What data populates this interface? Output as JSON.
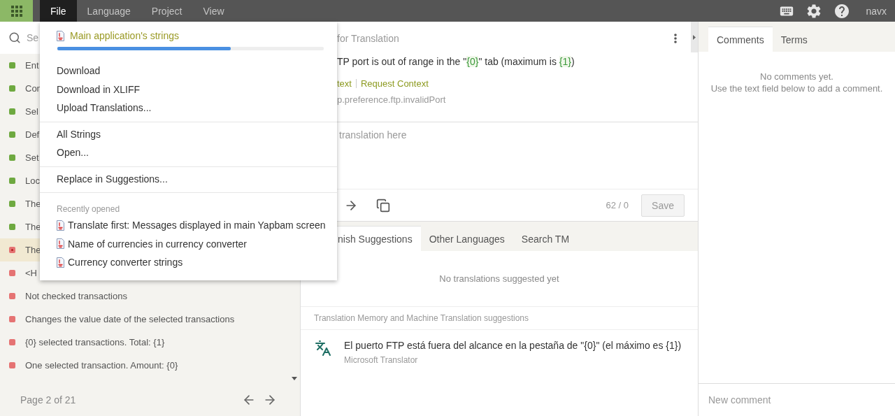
{
  "top_bar": {
    "menus": [
      {
        "label": "File",
        "selected": true
      },
      {
        "label": "Language",
        "selected": false
      },
      {
        "label": "Project",
        "selected": false
      },
      {
        "label": "View",
        "selected": false
      }
    ],
    "user": "navx"
  },
  "file_menu": {
    "current_file": {
      "name": "Main application's strings",
      "level": 0.65
    },
    "groups": [
      [
        "Download",
        "Download in XLIFF",
        "Upload Translations..."
      ],
      [
        "All Strings",
        "Open..."
      ],
      [
        "Replace in Suggestions..."
      ]
    ],
    "recent": {
      "heading": "Recently opened",
      "files": [
        "Translate first: Messages displayed in main Yapbam screen",
        "Name of currencies in currency converter",
        "Currency converter strings"
      ]
    }
  },
  "sidebar": {
    "search": {
      "placeholder": "Se"
    },
    "items": [
      {
        "text": "Ent",
        "color": "#6ea940",
        "selected": false
      },
      {
        "text": "Con",
        "color": "#6ea940",
        "selected": false
      },
      {
        "text": "Sel",
        "color": "#6ea940",
        "selected": false
      },
      {
        "text": "Def",
        "color": "#6ea940",
        "selected": false
      },
      {
        "text": "Set",
        "color": "#6ea940",
        "selected": false
      },
      {
        "text": "Loc",
        "color": "#6ea940",
        "selected": false
      },
      {
        "text": "The",
        "color": "#6ea940",
        "selected": false
      },
      {
        "text": "The",
        "color": "#6ea940",
        "selected": false
      },
      {
        "text": "The",
        "color": "#e57373",
        "selected": true
      },
      {
        "text": "<H",
        "color": "#e57373",
        "selected": false
      },
      {
        "text": "Not checked transactions",
        "color": "#e57373",
        "selected": false
      },
      {
        "text": "Changes the value date of the selected transactions",
        "color": "#e57373",
        "selected": false
      },
      {
        "text": "{0} selected transactions. Total: {1}",
        "color": "#e57373",
        "selected": false
      },
      {
        "text": "One selected transaction. Amount: {0}",
        "color": "#e57373",
        "selected": false
      }
    ],
    "page": "Page 2 of 21"
  },
  "editor": {
    "title": "for Translation",
    "source": [
      {
        "kind": "plain",
        "text": "TP port is out of range in the \""
      },
      {
        "kind": "placeholder",
        "text": "{0}"
      },
      {
        "kind": "plain",
        "text": "\" tab (maximum is "
      },
      {
        "kind": "placeholder",
        "text": "{1}"
      },
      {
        "kind": "plain",
        "text": ")"
      }
    ],
    "links": [
      "text",
      "Request Context"
    ],
    "key": "p.preference.ftp.invalidPort",
    "translation": {
      "placeholder": "translation here"
    },
    "counter": "62 / 0",
    "save": {
      "label": "Save",
      "disabled": true
    }
  },
  "suggestions": {
    "tabs": [
      {
        "label": "nish Suggestions",
        "selected": true
      },
      {
        "label": "Other Languages",
        "selected": false
      },
      {
        "label": "Search TM",
        "selected": false
      }
    ],
    "empty": "No translations suggested yet",
    "section": "Translation Memory and Machine Translation suggestions",
    "items": [
      {
        "text": "El puerto FTP está fuera del alcance en la pestaña de \"{0}\" (el máximo es {1})",
        "source": "Microsoft Translator"
      }
    ]
  },
  "side_panel": {
    "tabs": [
      {
        "label": "Comments",
        "selected": true
      },
      {
        "label": "Terms",
        "selected": false
      }
    ],
    "empty": [
      "No comments yet.",
      "Use the text field below to add a comment."
    ],
    "new_comment": {
      "placeholder": "New comment"
    }
  }
}
